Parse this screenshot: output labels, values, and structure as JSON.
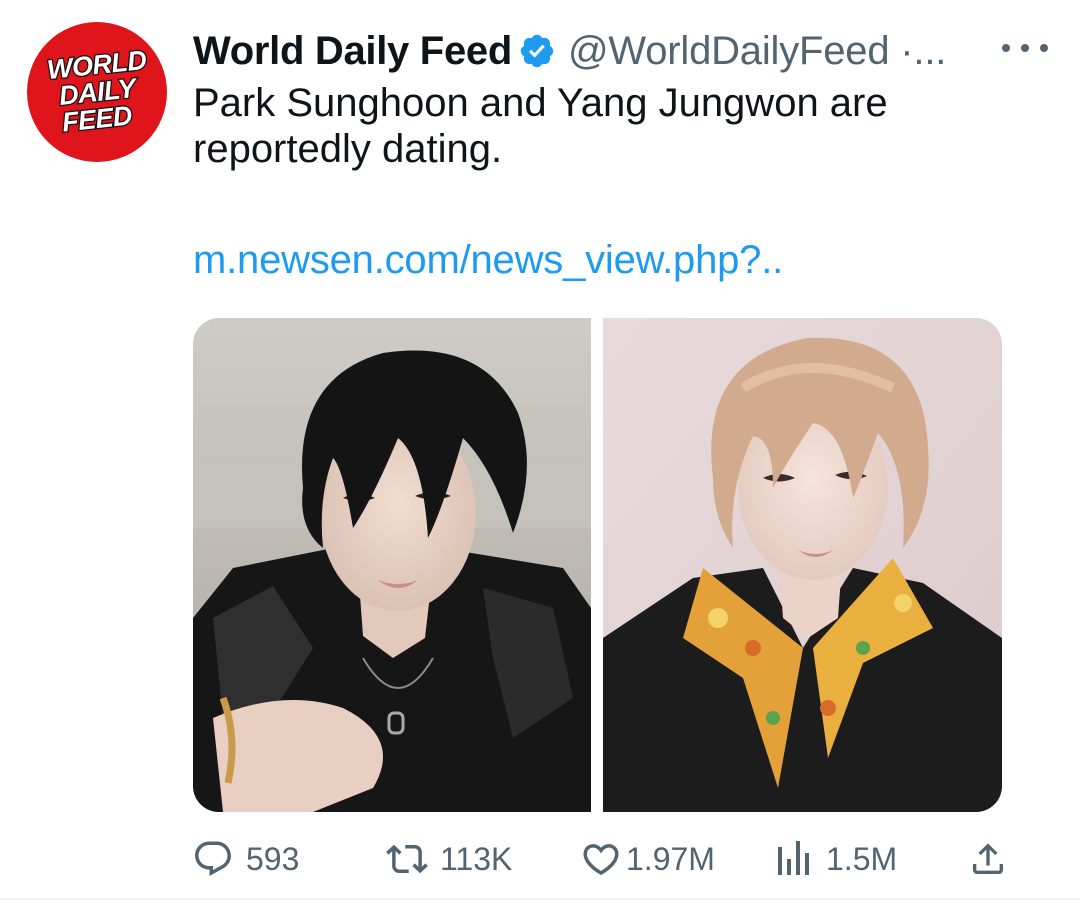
{
  "avatar": {
    "lines": [
      "WORLD",
      "DAILY",
      "FEED"
    ],
    "color": "#e0141b"
  },
  "author": {
    "display_name": "World Daily Feed",
    "handle": "@WorldDailyFeed ·...",
    "verified_icon": "verified-badge-icon"
  },
  "more_icon": "more-options-icon",
  "tweet": {
    "text": "Park Sunghoon and Yang Jungwon are reportedly dating.",
    "link": "m.newsen.com/news_view.php?.."
  },
  "media": [
    {
      "name": "photo-left",
      "description_icon": "photo"
    },
    {
      "name": "photo-right",
      "description_icon": "photo"
    }
  ],
  "actions": {
    "reply": {
      "icon": "reply-icon",
      "count": "593"
    },
    "retweet": {
      "icon": "retweet-icon",
      "count": "113K"
    },
    "like": {
      "icon": "heart-icon",
      "count": "1.97M"
    },
    "views": {
      "icon": "views-icon",
      "count": "1.5M"
    },
    "share": {
      "icon": "share-icon"
    }
  },
  "colors": {
    "accent": "#1d9bf0",
    "text": "#0f1419",
    "secondary": "#536471",
    "avatar_red": "#e0141b"
  }
}
